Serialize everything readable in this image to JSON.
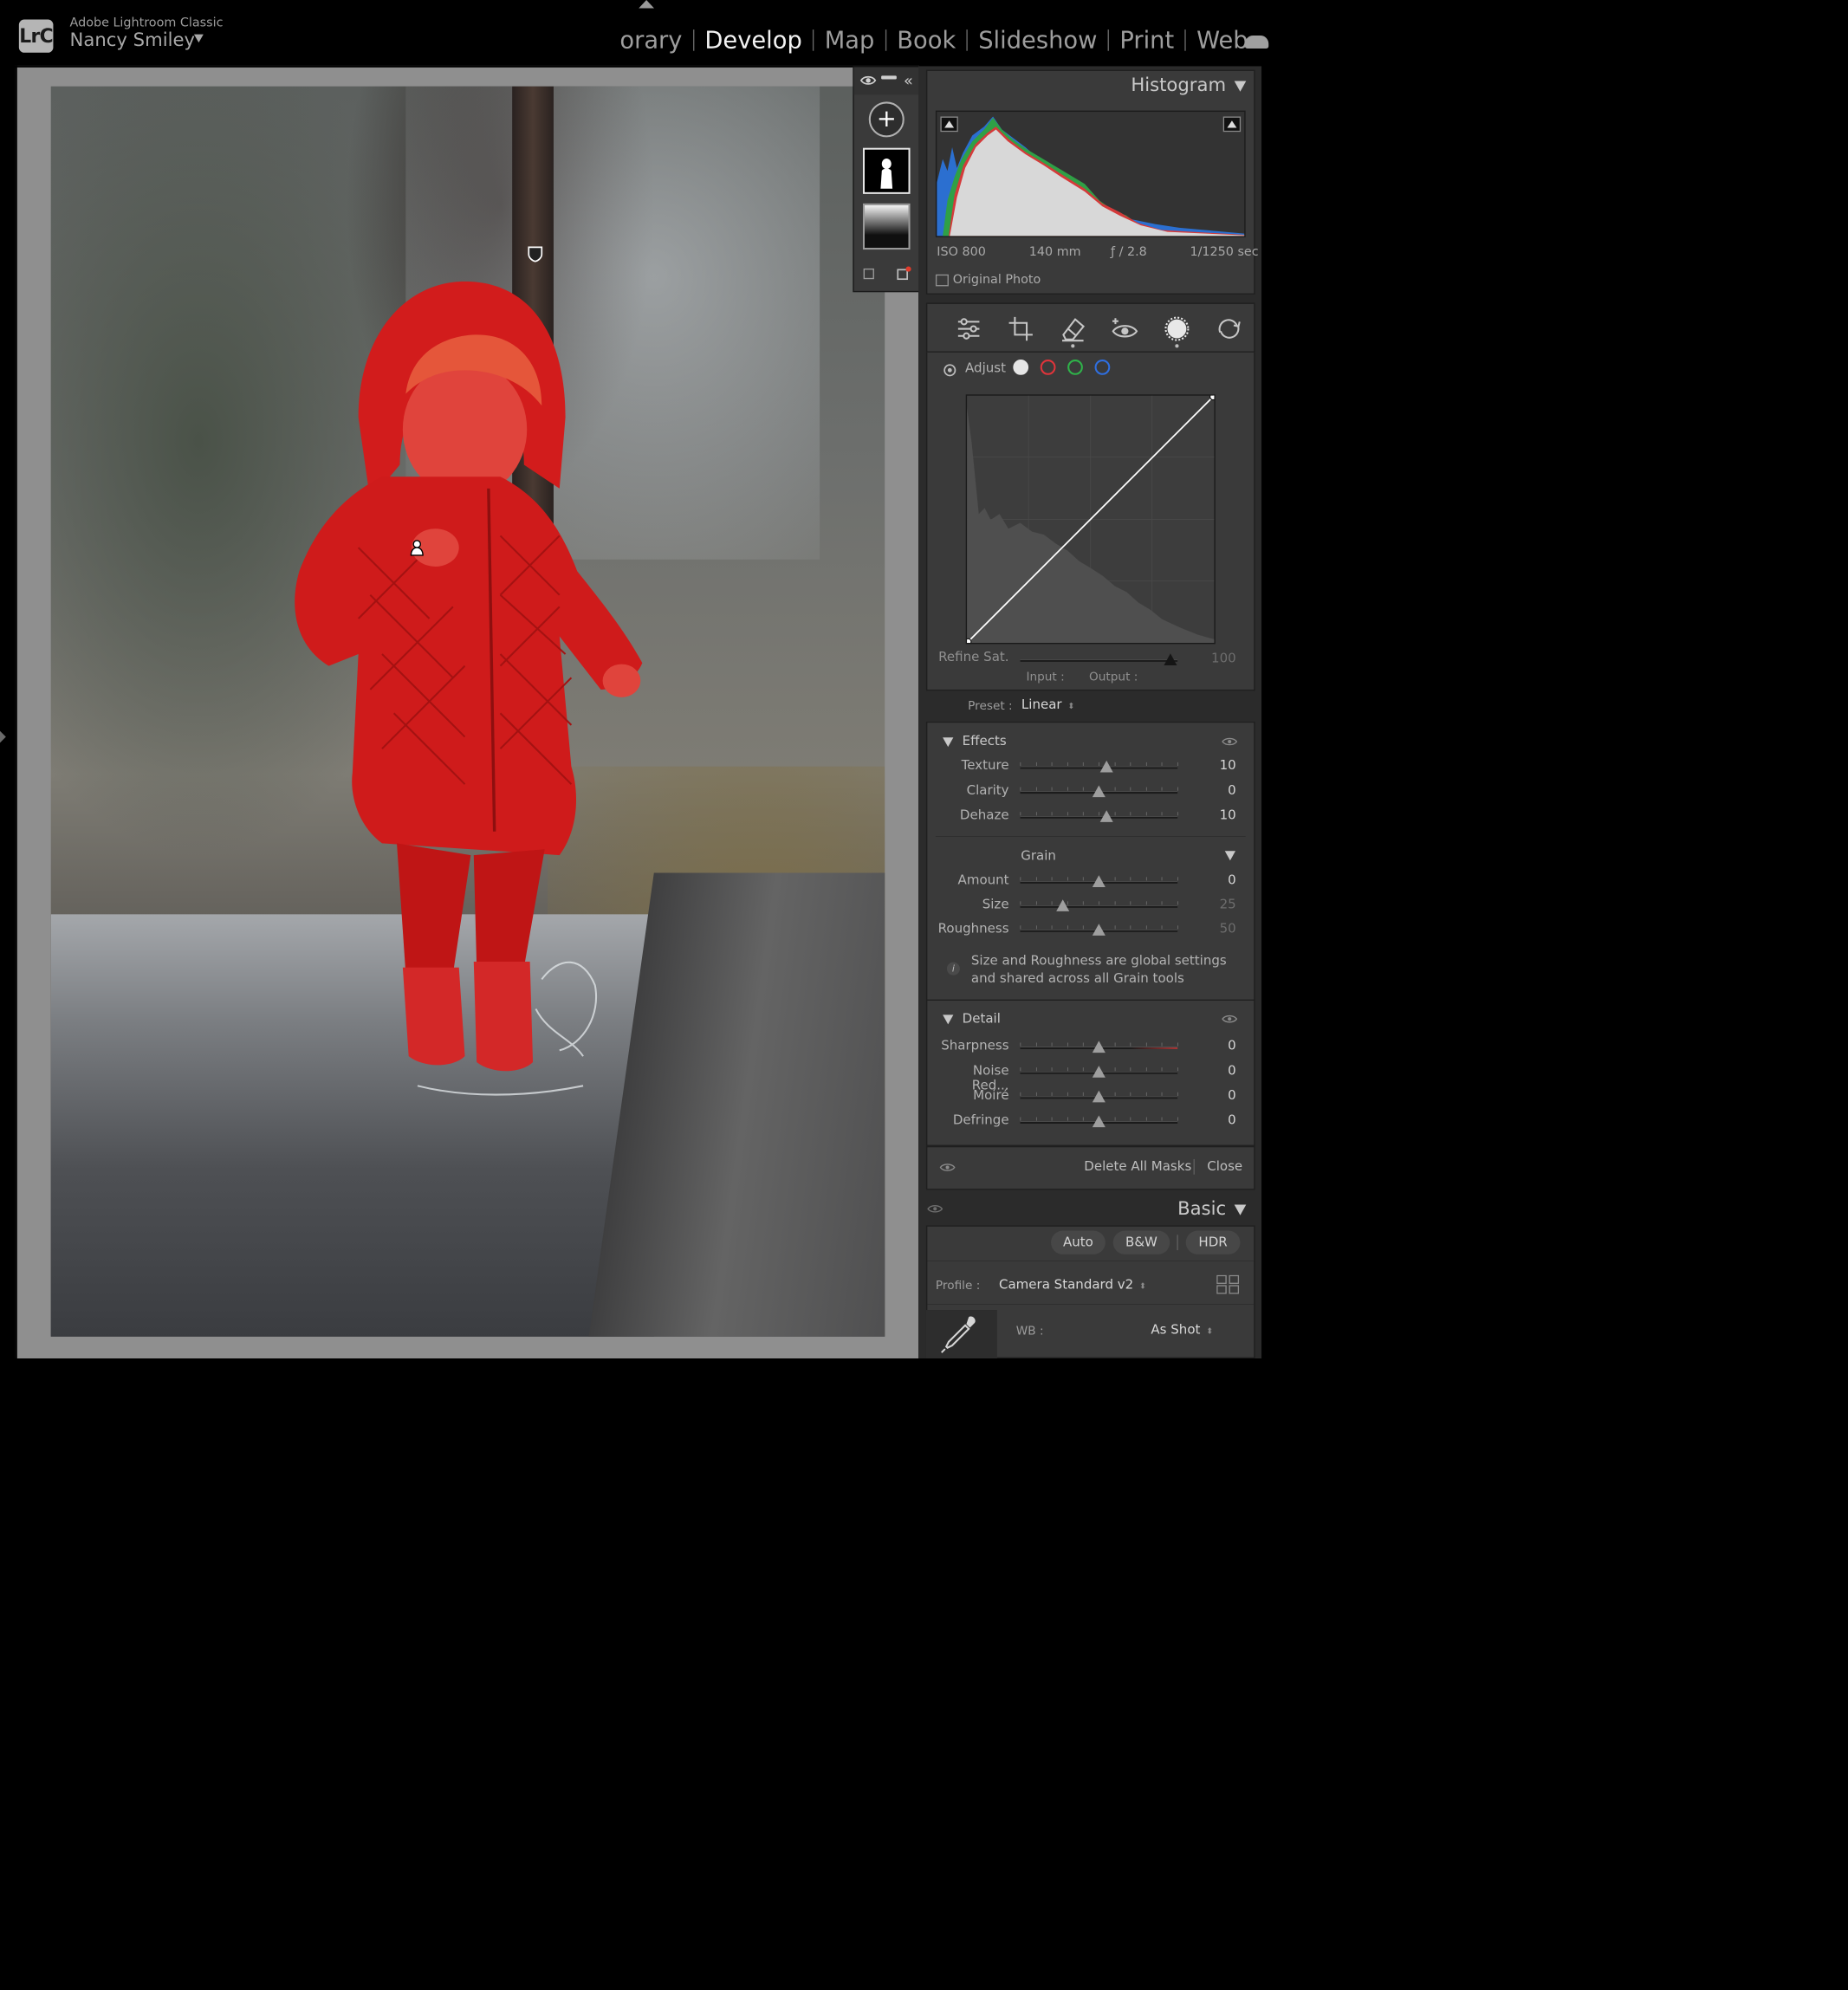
{
  "app": {
    "logo_text": "LrC",
    "app_name": "Adobe Lightroom Classic",
    "user_name": "Nancy Smiley"
  },
  "modules": [
    {
      "label": "orary",
      "active": false
    },
    {
      "label": "Develop",
      "active": true
    },
    {
      "label": "Map",
      "active": false
    },
    {
      "label": "Book",
      "active": false
    },
    {
      "label": "Slideshow",
      "active": false
    },
    {
      "label": "Print",
      "active": false
    },
    {
      "label": "Web",
      "active": false
    }
  ],
  "mask_panel": {
    "add_label": "+",
    "masks": [
      {
        "name": "mask-subject-thumbnail",
        "selected": true
      },
      {
        "name": "mask-linear-gradient-thumbnail",
        "selected": false
      }
    ]
  },
  "histogram": {
    "title": "Histogram",
    "iso": "ISO 800",
    "focal_length": "140 mm",
    "aperture": "ƒ / 2.8",
    "shutter": "1/1250 sec",
    "original_photo_label": "Original Photo"
  },
  "tool_strip": [
    "sliders-icon",
    "crop-icon",
    "healing-eraser-icon",
    "redeye-icon",
    "masking-icon",
    "reset-icon"
  ],
  "curve": {
    "adjust_label": "Adjust",
    "channels": [
      {
        "name": "channel-white",
        "color": "#e6e6e6",
        "filled": true
      },
      {
        "name": "channel-red",
        "color": "#e0343a",
        "filled": false
      },
      {
        "name": "channel-green",
        "color": "#2fb34a",
        "filled": false
      },
      {
        "name": "channel-blue",
        "color": "#2f6fe0",
        "filled": false
      }
    ],
    "refine_label": "Refine Sat.",
    "refine_value": "100",
    "input_label": "Input :",
    "output_label": "Output :",
    "preset_label": "Preset :",
    "preset_value": "Linear"
  },
  "effects": {
    "title": "Effects",
    "sliders": [
      {
        "label": "Texture",
        "value": "10",
        "level": 0.55
      },
      {
        "label": "Clarity",
        "value": "0",
        "level": 0.5
      },
      {
        "label": "Dehaze",
        "value": "10",
        "level": 0.55
      }
    ],
    "grain_title": "Grain",
    "grain_sliders": [
      {
        "label": "Amount",
        "value": "0",
        "level": 0.5,
        "dim": false
      },
      {
        "label": "Size",
        "value": "25",
        "level": 0.27,
        "dim": true
      },
      {
        "label": "Roughness",
        "value": "50",
        "level": 0.5,
        "dim": true
      }
    ],
    "info_text": "Size and Roughness are global settings and shared across all Grain tools"
  },
  "detail": {
    "title": "Detail",
    "sliders": [
      {
        "label": "Sharpness",
        "value": "0",
        "level": 0.5
      },
      {
        "label": "Noise Red...",
        "value": "0",
        "level": 0.5
      },
      {
        "label": "Moiré",
        "value": "0",
        "level": 0.5
      },
      {
        "label": "Defringe",
        "value": "0",
        "level": 0.5
      }
    ]
  },
  "mask_footer": {
    "delete_all_label": "Delete All Masks",
    "close_label": "Close"
  },
  "basic": {
    "title": "Basic",
    "auto_label": "Auto",
    "bw_label": "B&W",
    "hdr_label": "HDR",
    "profile_label": "Profile :",
    "profile_value": "Camera Standard v2",
    "wb_label": "WB :",
    "wb_value": "As Shot"
  },
  "colors": {
    "accent_active": "#f2f2f2",
    "mask_overlay": "#e01e1e",
    "panel_bg": "#3a3a3a"
  }
}
